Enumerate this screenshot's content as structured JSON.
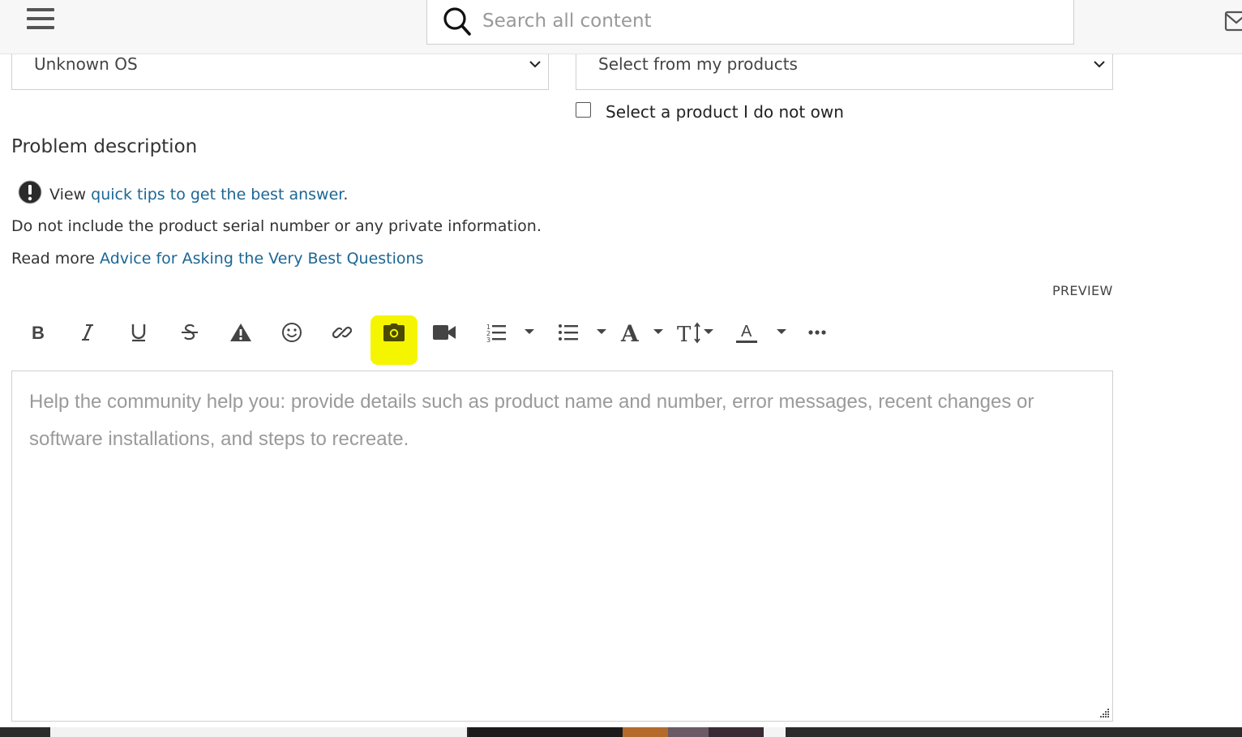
{
  "header": {
    "search_placeholder": "Search all content"
  },
  "form": {
    "os_select_value": "Unknown OS",
    "product_select_value": "Select from my products",
    "not_own_label": "Select a product I do not own",
    "section_title": "Problem description",
    "tip_prefix": "View ",
    "tip_link": "quick tips to get the best answer",
    "tip_suffix": ".",
    "privacy_note": "Do not include the product serial number or any private information.",
    "read_more_prefix": "Read more ",
    "read_more_link": "Advice for Asking the Very Best Questions"
  },
  "editor": {
    "preview_label": "PREVIEW",
    "placeholder": "Help the community help you: provide details such as product name and number, error messages, recent changes or software installations, and steps to recreate.",
    "toolbar": [
      "bold-icon",
      "italic-icon",
      "underline-icon",
      "strikethrough-icon",
      "warning-icon",
      "emoji-icon",
      "link-icon",
      "camera-icon",
      "video-icon",
      "numbered-list-icon",
      "bulleted-list-icon",
      "font-family-icon",
      "font-size-icon",
      "text-color-icon",
      "more-icon"
    ],
    "highlight_color": "#f5f500"
  },
  "colors": {
    "link": "#1c6694",
    "header_bg": "#f7f7f7"
  }
}
